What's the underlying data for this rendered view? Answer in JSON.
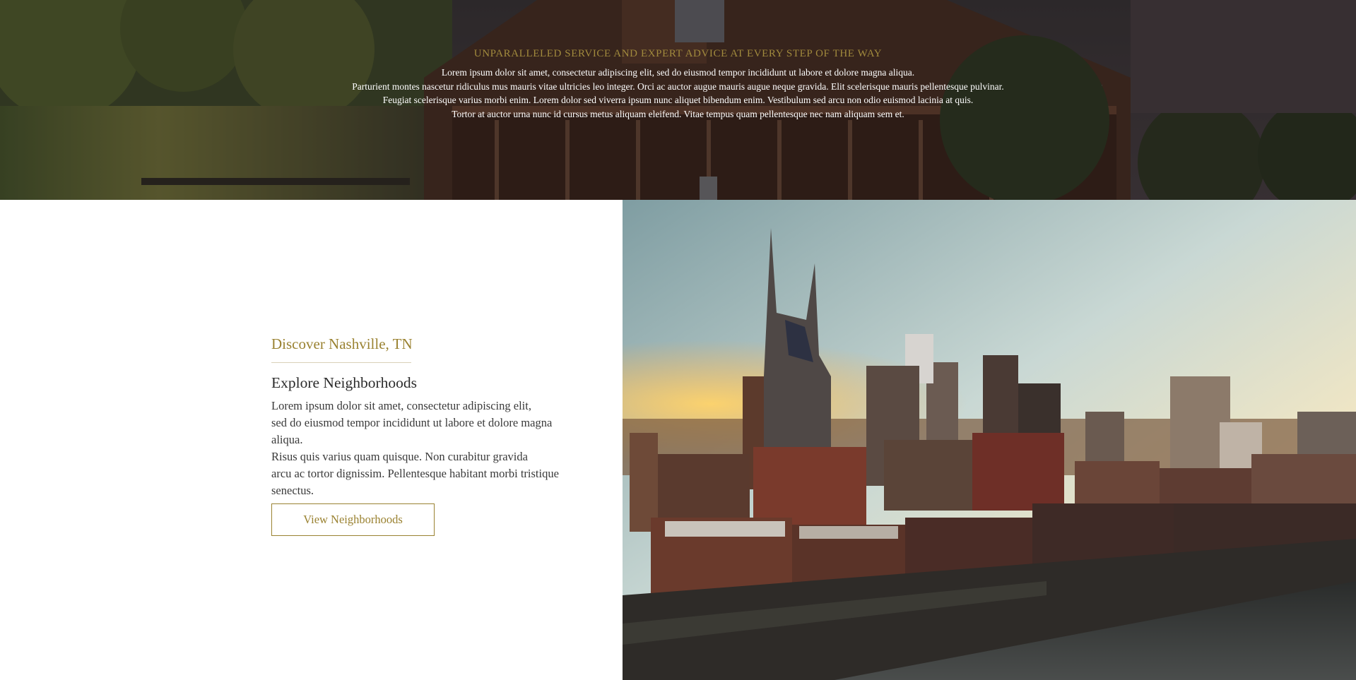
{
  "hero": {
    "eyebrow": "UNPARALLELED SERVICE AND EXPERT ADVICE AT EVERY STEP OF THE WAY",
    "lines": [
      "Lorem ipsum dolor sit amet, consectetur adipiscing elit, sed do eiusmod tempor incididunt ut labore et dolore magna aliqua.",
      "Parturient montes nascetur ridiculus mus mauris vitae ultricies leo integer. Orci ac auctor augue mauris augue neque gravida. Elit scelerisque mauris pellentesque pulvinar.",
      "Feugiat scelerisque varius morbi enim. Lorem dolor sed viverra ipsum nunc aliquet bibendum enim. Vestibulum sed arcu non odio euismod lacinia at quis.",
      "Tortor at auctor urna nunc id cursus metus aliquam eleifend. Vitae tempus quam pellentesque nec nam aliquam sem et."
    ],
    "background_image": "house-exterior-photo"
  },
  "section": {
    "subtitle": "Discover Nashville, TN",
    "heading": "Explore Neighborhoods",
    "paragraph1_line1": "Lorem ipsum dolor sit amet, consectetur adipiscing elit,",
    "paragraph1_line2": "sed do eiusmod tempor incididunt ut labore et dolore magna",
    "paragraph1_line3": "aliqua.",
    "paragraph2_line1": "Risus quis varius quam quisque. Non curabitur gravida",
    "paragraph2_line2": "arcu ac tortor dignissim. Pellentesque habitant morbi tristique",
    "paragraph2_line3": "senectus.",
    "button_label": "View Neighborhoods",
    "image": "nashville-skyline-photo"
  },
  "colors": {
    "accent_gold": "#9a8231",
    "text_dark": "#2b2b2b",
    "hero_overlay": "#2a2523"
  }
}
